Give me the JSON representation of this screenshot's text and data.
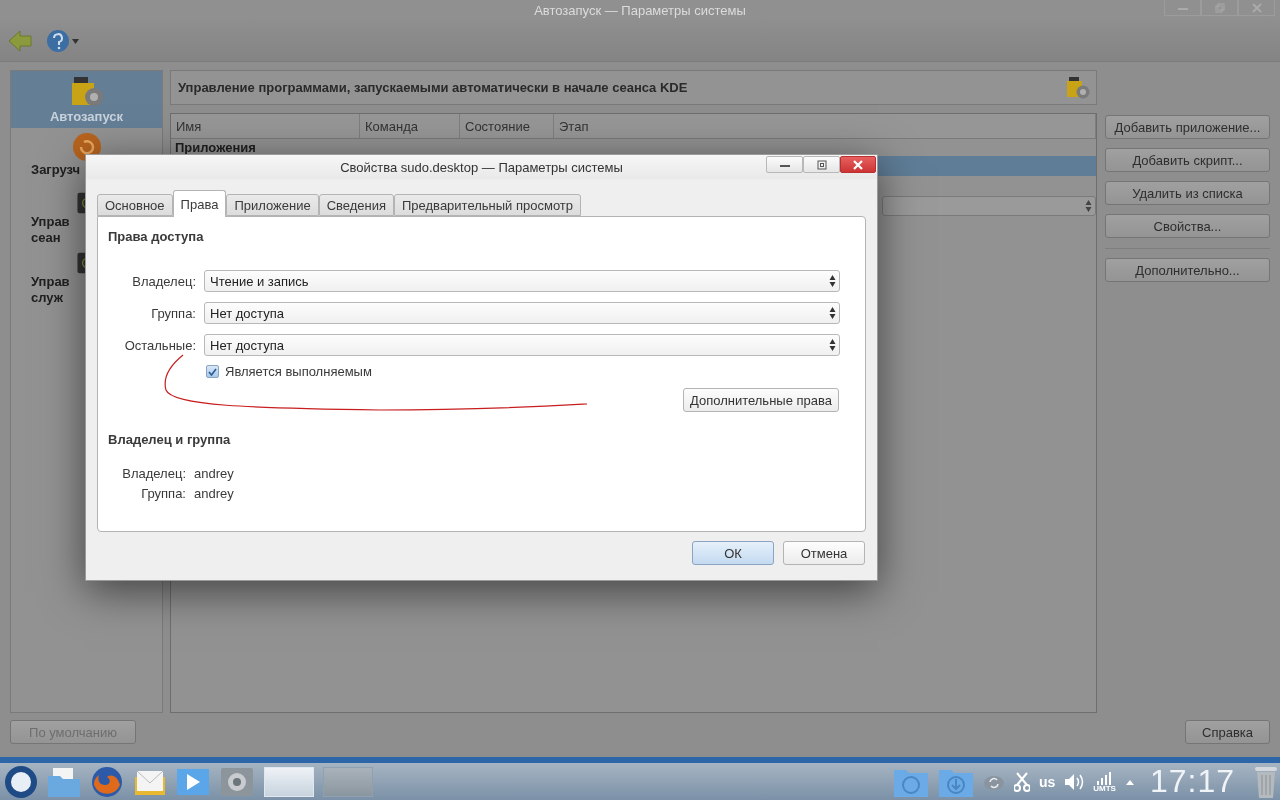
{
  "window": {
    "title": "Автозапуск — Параметры системы"
  },
  "sidebar": {
    "items": [
      {
        "lines": [
          "Автозапуск"
        ],
        "selected": true
      },
      {
        "lines": [
          "Загрузч"
        ],
        "selected": false
      },
      {
        "lines": [
          "Управ",
          "сеан"
        ],
        "selected": false
      },
      {
        "lines": [
          "Управ",
          "служ"
        ],
        "selected": false
      }
    ]
  },
  "header": {
    "text": "Управление программами, запускаемыми автоматически в начале сеанса KDE"
  },
  "table": {
    "columns": [
      "Имя",
      "Команда",
      "Состояние",
      "Этап"
    ],
    "group": "Приложения",
    "rows": [
      {
        "kind": "plain",
        "selected": true
      },
      {
        "kind": "plain",
        "selected": false
      },
      {
        "kind": "combo",
        "selected": false
      }
    ]
  },
  "side_buttons": [
    "Добавить приложение...",
    "Добавить скрипт...",
    "Удалить из списка",
    "Свойства..."
  ],
  "extra_button": "Дополнительно...",
  "default_button": "По умолчанию",
  "help_button": "Справка",
  "dialog": {
    "title": "Свойства sudo.desktop — Параметры системы",
    "tabs": [
      {
        "label": "Основное",
        "selected": false
      },
      {
        "label": "Права",
        "selected": true
      },
      {
        "label": "Приложение",
        "selected": false
      },
      {
        "label": "Сведения",
        "selected": false
      },
      {
        "label": "Предварительный просмотр",
        "selected": false
      }
    ],
    "section_title": "Права доступа",
    "permissions": [
      {
        "label": "Владелец:",
        "value": "Чтение и запись"
      },
      {
        "label": "Группа:",
        "value": "Нет доступа"
      },
      {
        "label": "Остальные:",
        "value": "Нет доступа"
      }
    ],
    "executable": {
      "label": "Является выполняемым",
      "checked": true
    },
    "advanced_button": "Дополнительные права",
    "ownership_title": "Владелец и группа",
    "ownership": [
      {
        "label": "Владелец:",
        "value": "andrey"
      },
      {
        "label": "Группа:",
        "value": "andrey"
      }
    ],
    "buttons": [
      {
        "label": "ОК",
        "default": true
      },
      {
        "label": "Отмена",
        "default": false
      }
    ]
  },
  "taskbar": {
    "keyboard_layout": "us",
    "signal_label": "UMTS",
    "clock": "17:17"
  }
}
